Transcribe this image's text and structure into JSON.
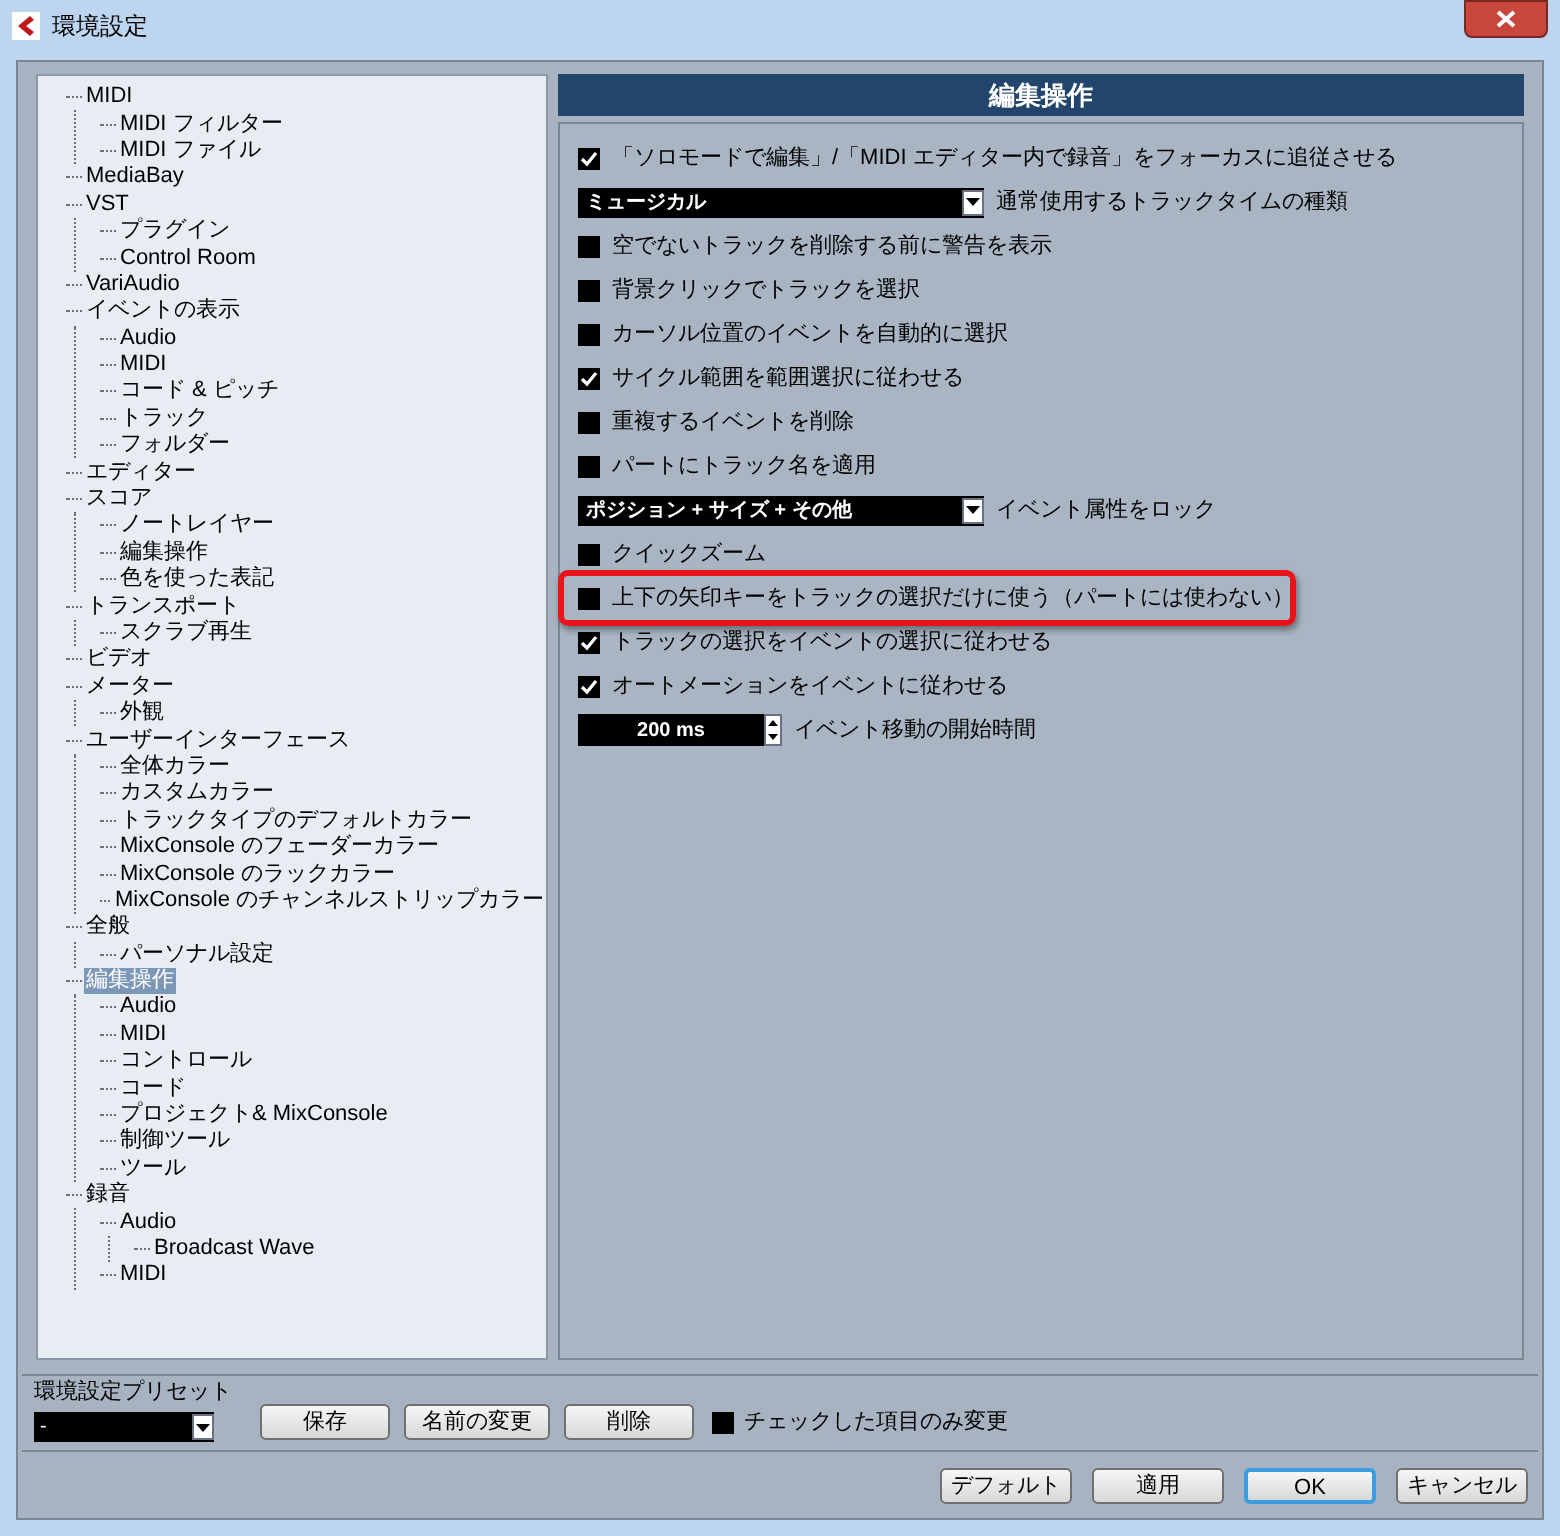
{
  "window": {
    "title": "環境設定"
  },
  "tree": [
    {
      "label": "MIDI",
      "selected": false,
      "children": [
        {
          "label": "MIDI フィルター",
          "selected": false
        },
        {
          "label": "MIDI ファイル",
          "selected": false
        }
      ]
    },
    {
      "label": "MediaBay",
      "selected": false
    },
    {
      "label": "VST",
      "selected": false,
      "children": [
        {
          "label": "プラグイン",
          "selected": false
        },
        {
          "label": "Control Room",
          "selected": false
        }
      ]
    },
    {
      "label": "VariAudio",
      "selected": false
    },
    {
      "label": "イベントの表示",
      "selected": false,
      "children": [
        {
          "label": "Audio",
          "selected": false
        },
        {
          "label": "MIDI",
          "selected": false
        },
        {
          "label": "コード & ピッチ",
          "selected": false
        },
        {
          "label": "トラック",
          "selected": false
        },
        {
          "label": "フォルダー",
          "selected": false
        }
      ]
    },
    {
      "label": "エディター",
      "selected": false
    },
    {
      "label": "スコア",
      "selected": false,
      "children": [
        {
          "label": "ノートレイヤー",
          "selected": false
        },
        {
          "label": "編集操作",
          "selected": false
        },
        {
          "label": "色を使った表記",
          "selected": false
        }
      ]
    },
    {
      "label": "トランスポート",
      "selected": false,
      "children": [
        {
          "label": "スクラブ再生",
          "selected": false
        }
      ]
    },
    {
      "label": "ビデオ",
      "selected": false
    },
    {
      "label": "メーター",
      "selected": false,
      "children": [
        {
          "label": "外観",
          "selected": false
        }
      ]
    },
    {
      "label": "ユーザーインターフェース",
      "selected": false,
      "children": [
        {
          "label": "全体カラー",
          "selected": false
        },
        {
          "label": "カスタムカラー",
          "selected": false
        },
        {
          "label": "トラックタイプのデフォルトカラー",
          "selected": false
        },
        {
          "label": "MixConsole のフェーダーカラー",
          "selected": false
        },
        {
          "label": "MixConsole のラックカラー",
          "selected": false
        },
        {
          "label": "MixConsole のチャンネルストリップカラー",
          "selected": false
        }
      ]
    },
    {
      "label": "全般",
      "selected": false,
      "children": [
        {
          "label": "パーソナル設定",
          "selected": false
        }
      ]
    },
    {
      "label": "編集操作",
      "selected": true,
      "children": [
        {
          "label": "Audio",
          "selected": false
        },
        {
          "label": "MIDI",
          "selected": false
        },
        {
          "label": "コントロール",
          "selected": false
        },
        {
          "label": "コード",
          "selected": false
        },
        {
          "label": "プロジェクト& MixConsole",
          "selected": false
        },
        {
          "label": "制御ツール",
          "selected": false
        },
        {
          "label": "ツール",
          "selected": false
        }
      ]
    },
    {
      "label": "録音",
      "selected": false,
      "children": [
        {
          "label": "Audio",
          "selected": false,
          "children": [
            {
              "label": "Broadcast Wave",
              "selected": false
            }
          ]
        },
        {
          "label": "MIDI",
          "selected": false
        }
      ]
    }
  ],
  "panel": {
    "title": "編集操作",
    "settings": [
      {
        "kind": "checkbox",
        "label": "「ソロモードで編集」/「MIDI エディター内で録音」をフォーカスに追従させる",
        "checked": true,
        "highlighted": false
      },
      {
        "kind": "dropdown",
        "label": "通常使用するトラックタイムの種類",
        "current": "ミュージカル",
        "highlighted": false
      },
      {
        "kind": "checkbox",
        "label": "空でないトラックを削除する前に警告を表示",
        "checked": false,
        "highlighted": false
      },
      {
        "kind": "checkbox",
        "label": "背景クリックでトラックを選択",
        "checked": false,
        "highlighted": false
      },
      {
        "kind": "checkbox",
        "label": "カーソル位置のイベントを自動的に選択",
        "checked": false,
        "highlighted": false
      },
      {
        "kind": "checkbox",
        "label": "サイクル範囲を範囲選択に従わせる",
        "checked": true,
        "highlighted": false
      },
      {
        "kind": "checkbox",
        "label": "重複するイベントを削除",
        "checked": false,
        "highlighted": false
      },
      {
        "kind": "checkbox",
        "label": "パートにトラック名を適用",
        "checked": false,
        "highlighted": false
      },
      {
        "kind": "dropdown",
        "label": "イベント属性をロック",
        "current": "ポジション + サイズ + その他",
        "highlighted": false
      },
      {
        "kind": "checkbox",
        "label": "クイックズーム",
        "checked": false,
        "highlighted": false
      },
      {
        "kind": "checkbox",
        "label": "上下の矢印キーをトラックの選択だけに使う（パートには使わない）",
        "checked": false,
        "highlighted": true
      },
      {
        "kind": "checkbox",
        "label": "トラックの選択をイベントの選択に従わせる",
        "checked": true,
        "highlighted": false
      },
      {
        "kind": "checkbox",
        "label": "オートメーションをイベントに従わせる",
        "checked": true,
        "highlighted": false
      },
      {
        "kind": "spinner",
        "label": "イベント移動の開始時間",
        "current": "200 ms",
        "highlighted": false
      }
    ]
  },
  "preset": {
    "label": "環境設定プリセット",
    "value": "-",
    "buttons": [
      "保存",
      "名前の変更",
      "削除"
    ],
    "only_checked": {
      "label": "チェックした項目のみ変更",
      "checked": false
    }
  },
  "footer_buttons": [
    {
      "label": "デフォルト",
      "default": false
    },
    {
      "label": "適用",
      "default": false
    },
    {
      "label": "OK",
      "default": true
    },
    {
      "label": "キャンセル",
      "default": false
    }
  ]
}
